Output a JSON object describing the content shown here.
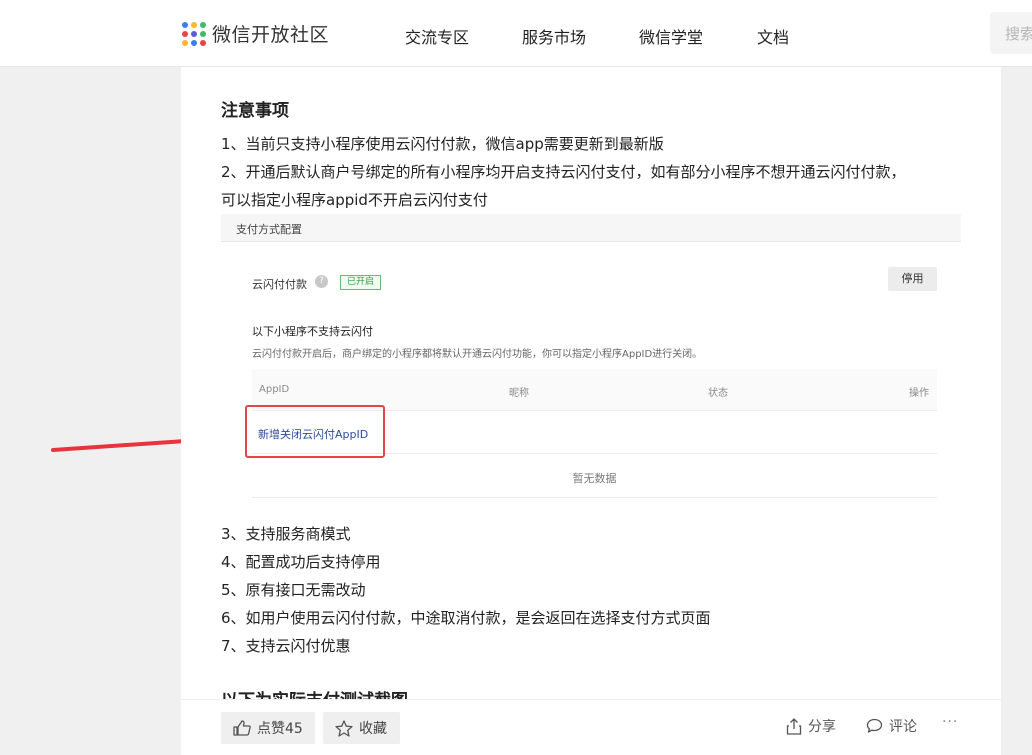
{
  "nav": {
    "logo_text": "微信开放社区",
    "items": [
      "交流专区",
      "服务市场",
      "微信学堂",
      "文档"
    ],
    "search_placeholder": "搜索"
  },
  "article": {
    "section_title": "注意事项",
    "items_top": [
      "1、当前只支持小程序使用云闪付付款，微信app需要更新到最新版",
      "2、开通后默认商户号绑定的所有小程序均开启支持云闪付支付，如有部分小程序不想开通云闪付付款，",
      "可以指定小程序appid不开启云闪付支付"
    ],
    "items_bottom": [
      "3、支持服务商模式",
      "4、配置成功后支持停用",
      "5、原有接口无需改动",
      "6、如用户使用云闪付付款，中途取消付款，是会返回在选择支付方式页面",
      "7、支持云闪付优惠"
    ],
    "next_title": "以下为实际支付测试截图"
  },
  "screenshot": {
    "header": "支付方式配置",
    "feature_label": "云闪付付款",
    "help_glyph": "?",
    "status_badge": "已开启",
    "disable_button": "停用",
    "list_title": "以下小程序不支持云闪付",
    "list_desc": "云闪付付款开启后，商户绑定的小程序都将默认开通云闪付功能，你可以指定小程序AppID进行关闭。",
    "columns": [
      "AppID",
      "昵称",
      "状态",
      "操作"
    ],
    "add_link": "新增关闭云闪付AppID",
    "empty_text": "暂无数据"
  },
  "actions": {
    "like_label": "点赞45",
    "fav_label": "收藏",
    "share_label": "分享",
    "comment_label": "评论",
    "more_label": "···"
  },
  "colors": {
    "highlight_box": "#e8434a",
    "arrow": "#e8343c",
    "link": "#2b4b9b",
    "badge": "#29a33c"
  }
}
